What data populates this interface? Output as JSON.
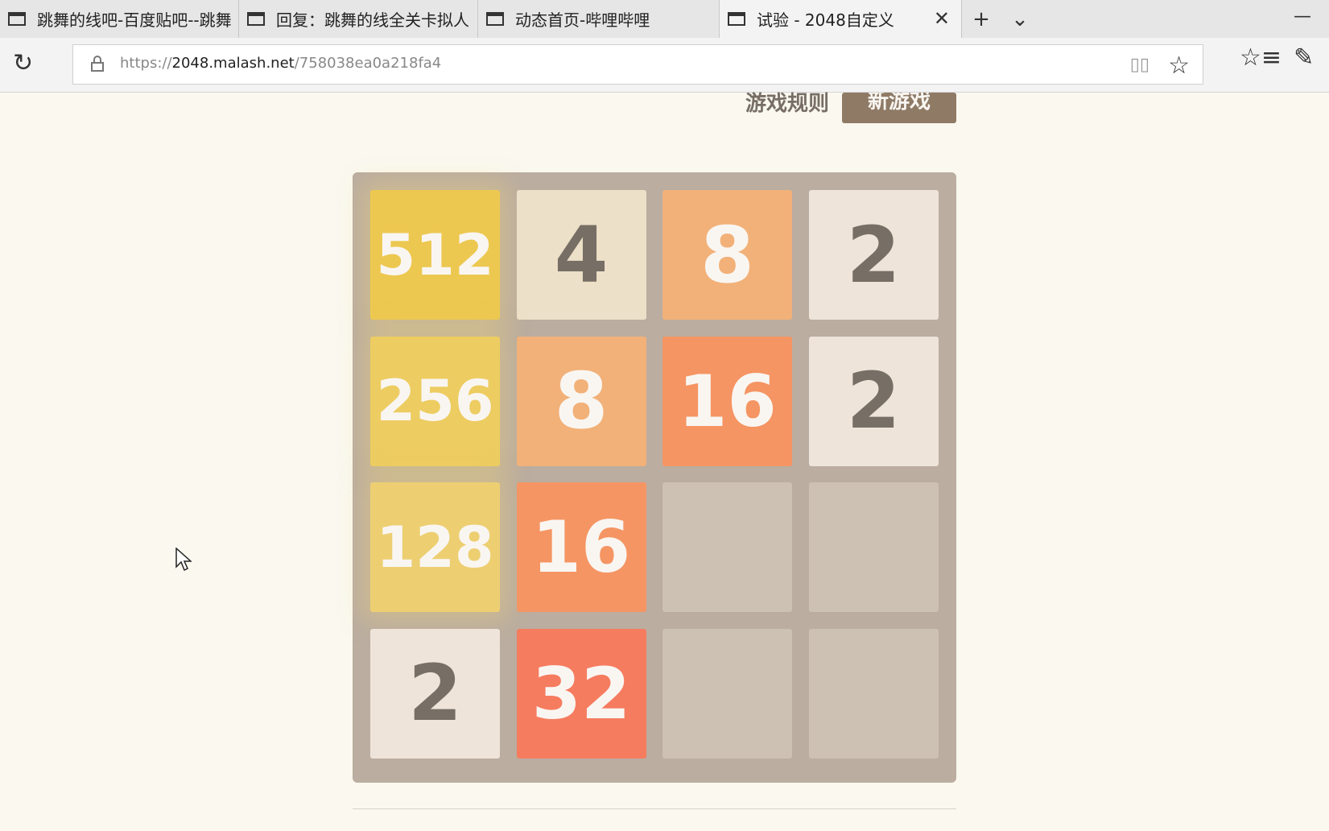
{
  "browser": {
    "tabs": [
      {
        "title": "跳舞的线吧-百度贴吧--跳舞",
        "active": false
      },
      {
        "title": "回复：跳舞的线全关卡拟人",
        "active": false
      },
      {
        "title": "动态首页-哔哩哔哩",
        "active": false
      },
      {
        "title": "试验 - 2048自定义",
        "active": true
      }
    ],
    "url_prefix": "https://",
    "url_host": "2048.malash.net",
    "url_path": "/758038ea0a218fa4",
    "icons": [
      "refresh-icon",
      "lock-icon",
      "reading-view-icon",
      "favorite-star-icon",
      "favorites-list-icon",
      "pen-icon",
      "new-tab-icon",
      "tab-list-icon",
      "minimize-icon"
    ]
  },
  "game": {
    "rules_label": "游戏规则",
    "new_game_label": "新游戏",
    "grid": [
      [
        512,
        4,
        8,
        2
      ],
      [
        256,
        8,
        16,
        2
      ],
      [
        128,
        16,
        null,
        null
      ],
      [
        2,
        32,
        null,
        null
      ]
    ],
    "tile_colors": {
      "2": {
        "bg": "#eee4da",
        "fg": "#776e65"
      },
      "4": {
        "bg": "#ede0c8",
        "fg": "#776e65"
      },
      "8": {
        "bg": "#f2b179",
        "fg": "#f9f6f2"
      },
      "16": {
        "bg": "#f59563",
        "fg": "#f9f6f2"
      },
      "32": {
        "bg": "#f67c5f",
        "fg": "#f9f6f2"
      },
      "128": {
        "bg": "#edcf72",
        "fg": "#f9f6f2"
      },
      "256": {
        "bg": "#edcc61",
        "fg": "#f9f6f2"
      },
      "512": {
        "bg": "#edc850",
        "fg": "#f9f6f2"
      },
      "empty": {
        "bg": "#cdc1b4"
      }
    }
  }
}
